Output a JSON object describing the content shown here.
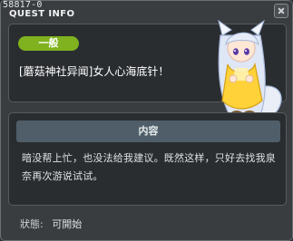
{
  "window": {
    "quest_id": "58817-0",
    "title": "QUEST INFO"
  },
  "quest": {
    "category": "一般",
    "name": "[蘑菇神社异闻]女人心海底针！",
    "content_header": "内容",
    "content_text": "暗没帮上忙，也没法给我建议。既然这样，只好去找我泉奈再次游说试试。"
  },
  "status": {
    "label": "狀態:",
    "value": "可開始"
  },
  "colors": {
    "badge": "#7fb21e",
    "content_header_bg": "#4f5e68",
    "window_bg": "#3a3d40",
    "panel_bg": "#2a2d30"
  },
  "icons": {
    "close": "close-icon",
    "character": "npc-fox-girl-portrait"
  }
}
